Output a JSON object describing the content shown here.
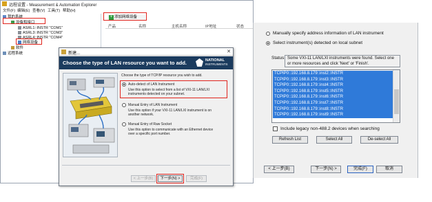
{
  "explorer": {
    "title": "远程设置 - Measurement & Automation Explorer",
    "menu": [
      "文件(F)",
      "编辑(E)",
      "查看(V)",
      "工具(T)",
      "帮助(H)"
    ],
    "tree": {
      "root": "我的系统",
      "devices": "设备和接口",
      "items": [
        "ASRL1::INSTR \"COM1\"",
        "ASRL3::INSTR \"COM3\"",
        "ASRL4::INSTR \"COM4\"",
        "网络设备"
      ],
      "software": "软件",
      "remote": "远程系统"
    },
    "add_button": "添加网络设备",
    "columns": [
      "产品",
      "名称",
      "主机名称",
      "IP地址",
      "状态"
    ]
  },
  "wizard": {
    "title": "新建...",
    "header": "Choose the type of LAN resource you want to add.",
    "logo_line1": "NATIONAL",
    "logo_line2": "INSTRUMENTS",
    "prompt": "Choose the type of TCP/IP resource you wish to add.",
    "options": [
      {
        "label": "Auto-detect of LAN Instrument",
        "desc1": "Use this option to select from a list of VXI-11 LAN/LXI",
        "desc2": "instruments detected on your subnet.",
        "selected": true
      },
      {
        "label": "Manual Entry of LAN Instrument",
        "desc1": "Use this option if your VXI-11 LAN/LXI instrument is on",
        "desc2": "another network.",
        "selected": false
      },
      {
        "label": "Manual Entry of Raw Socket",
        "desc1": "Use this option to communicate with an Ethernet device",
        "desc2": "over a specific port number.",
        "selected": false
      }
    ],
    "buttons": {
      "back": "< 上一步(B)",
      "next": "下一步(N) >",
      "finish": "完成(F)"
    }
  },
  "address_dialog": {
    "option_manual": "Manually specify address information of LAN instrument",
    "option_select": "Select instrument(s) detected on local subnet",
    "status_label": "Status:",
    "status_line1": "Some VXI-11 LAN/LXI instruments were found. Select one",
    "status_line2": "or more resources and click 'Next' or 'Finish'.",
    "resources": [
      "TCPIP0::192.168.8.179::inst2::INSTR",
      "TCPIP0::192.168.8.179::inst3::INSTR",
      "TCPIP0::192.168.8.179::inst4::INSTR",
      "TCPIP0::192.168.8.179::inst5::INSTR",
      "TCPIP0::192.168.8.179::inst6::INSTR",
      "TCPIP0::192.168.8.179::inst7::INSTR",
      "TCPIP0::192.168.8.179::inst8::INSTR",
      "TCPIP0::192.168.8.179::inst9::INSTR"
    ],
    "legacy_checkbox": "Include legacy non-488.2 devices when searching",
    "buttons": {
      "refresh": "Refresh List",
      "select_all": "Select All",
      "deselect_all": "De-select All",
      "back": "< 上一步(B)",
      "next": "下一步(N) >",
      "finish": "完成(F)",
      "cancel": "取消"
    }
  }
}
